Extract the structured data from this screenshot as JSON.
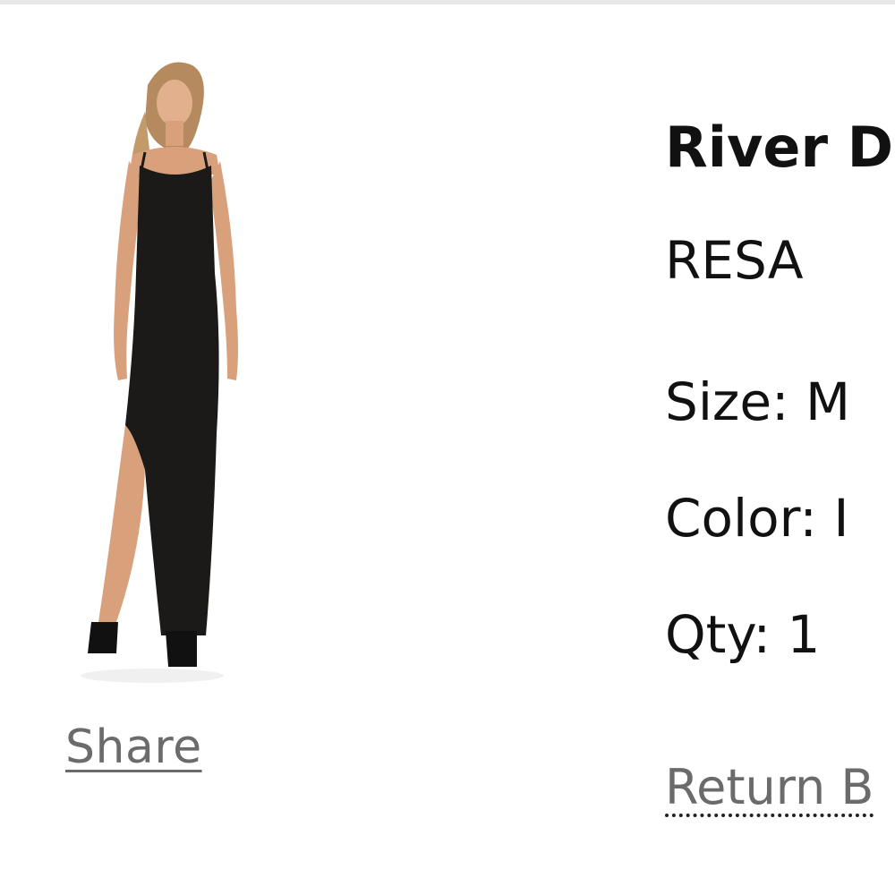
{
  "product": {
    "name": "River D",
    "brand": "RESA",
    "size_text": "Size: M",
    "color_text": "Color: I",
    "qty_text": "Qty: 1",
    "image_icon": "dress-photo",
    "colors": {
      "text": "#111111",
      "link": "#6b6b6b",
      "dress": "#1b1a19",
      "skin": "#d9a07c",
      "hair": "#b58a5e"
    }
  },
  "actions": {
    "share_label": "Share",
    "return_label": "Return B"
  }
}
